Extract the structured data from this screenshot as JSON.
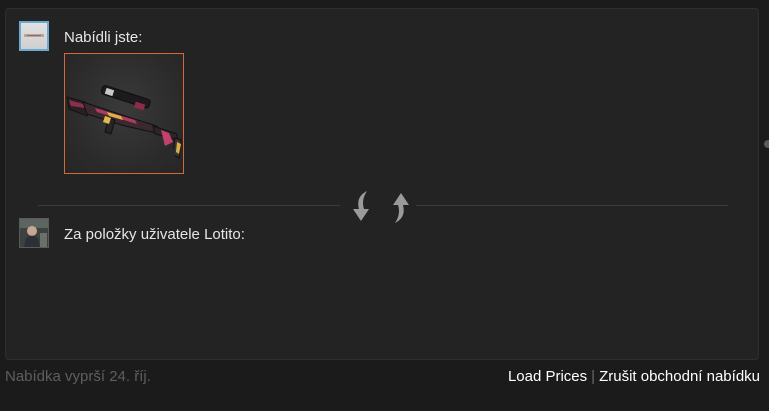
{
  "offer": {
    "you_label": "Nabídli jste:",
    "them_label": "Za položky uživatele Lotito:",
    "item_icon": "ssg08-rifle-icon"
  },
  "footer": {
    "expiry_text": "Nabídka vyprší 24. říj.",
    "load_prices_label": "Load Prices",
    "separator": "|",
    "cancel_label": "Zrušit obchodní nabídku"
  },
  "colors": {
    "item_border": "#d2693a",
    "avatar_you_border": "#6aa9d2",
    "arrow": "#9a9a9a"
  }
}
